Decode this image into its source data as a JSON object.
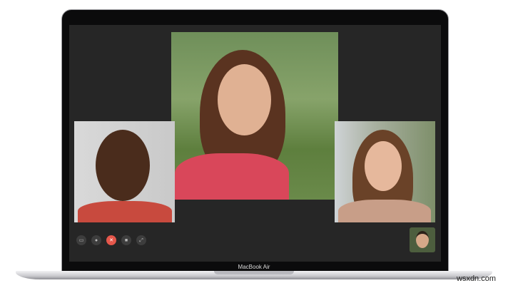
{
  "device": {
    "label": "MacBook Air"
  },
  "call": {
    "participants": [
      {
        "position": "center",
        "name": ""
      },
      {
        "position": "left",
        "name": ""
      },
      {
        "position": "right",
        "name": ""
      }
    ],
    "self_view": true
  },
  "controls": [
    {
      "id": "sidebar",
      "icon": "sidebar-icon"
    },
    {
      "id": "mute",
      "icon": "microphone-icon"
    },
    {
      "id": "end",
      "icon": "close-icon",
      "color": "#e5574b"
    },
    {
      "id": "camera",
      "icon": "video-camera-icon"
    },
    {
      "id": "fullscreen",
      "icon": "fullscreen-icon"
    }
  ],
  "watermark": "wsxdn.com"
}
